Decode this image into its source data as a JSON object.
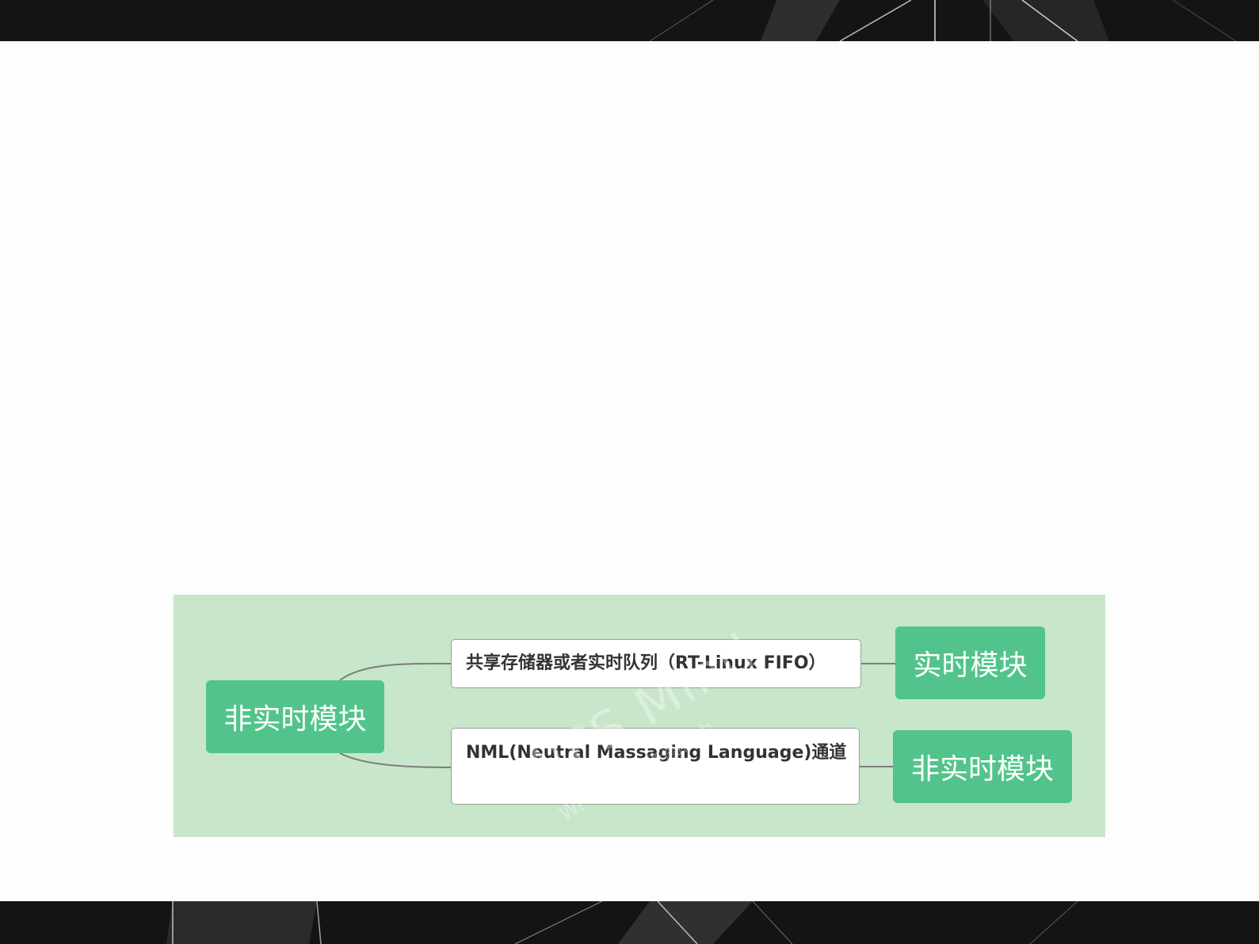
{
  "diagram": {
    "root": {
      "label": "非实时模块"
    },
    "channels": [
      {
        "label": "共享存储器或者实时队列（RT-Linux FIFO）"
      },
      {
        "label": "NML(Neutral Massaging Language)通道"
      }
    ],
    "targets": [
      {
        "label": "实时模块"
      },
      {
        "label": "非实时模块"
      }
    ],
    "watermark": {
      "main": "WPS Mind",
      "sub": "WPS仅提供作图能力"
    },
    "colors": {
      "panel_background": "#c8e6c9",
      "node_green": "#52c48b",
      "connector": "#7d7d7d",
      "band_dark": "#141414"
    }
  }
}
